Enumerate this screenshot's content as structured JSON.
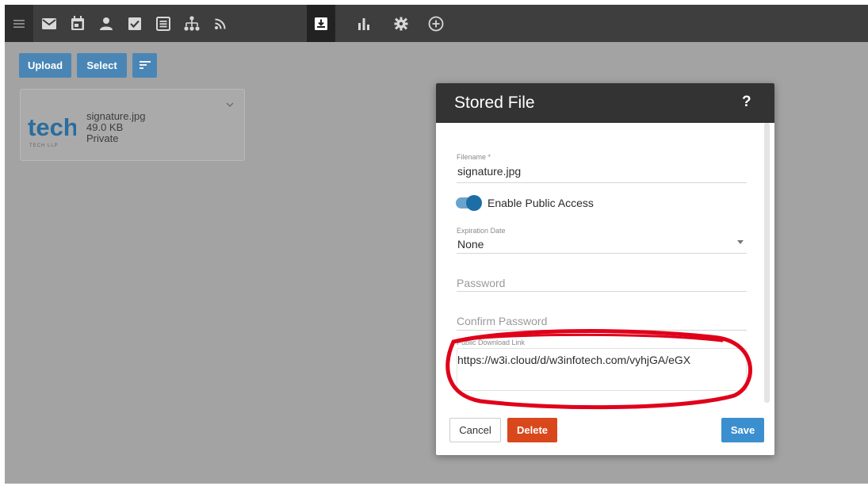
{
  "nav": {
    "icons": [
      "menu-icon",
      "mail-icon",
      "calendar-icon",
      "contacts-icon",
      "tasks-icon",
      "notes-icon",
      "org-chart-icon",
      "rss-icon",
      "files-icon",
      "reports-icon",
      "settings-icon",
      "add-icon"
    ],
    "active": "files-icon"
  },
  "toolbar": {
    "upload_label": "Upload",
    "select_label": "Select",
    "sort_icon": "sort-icon"
  },
  "file_card": {
    "filename": "signature.jpg",
    "size": "49.0 KB",
    "visibility": "Private",
    "thumb_logo_text": "tech",
    "thumb_logo_subtext": "TECH LLP"
  },
  "dialog": {
    "title": "Stored File",
    "help": "?",
    "filename_label": "Filename *",
    "filename_value": "signature.jpg",
    "public_access_label": "Enable Public Access",
    "public_access_enabled": true,
    "expiration_label": "Expiration Date",
    "expiration_value": "None",
    "password_placeholder": "Password",
    "confirm_password_placeholder": "Confirm Password",
    "download_link_label": "Public Download Link",
    "download_link_value": "https://w3i.cloud/d/w3infotech.com/vyhjGA/eGX",
    "cancel_label": "Cancel",
    "delete_label": "Delete",
    "save_label": "Save"
  },
  "colors": {
    "topbar": "#3e3e3e",
    "backdrop": "#a3a3a3",
    "primary_button": "#4a86b5",
    "delete_button": "#d9481c",
    "save_button": "#3b8fcf",
    "toggle": "#1e6ea6",
    "highlight": "#e0001a"
  }
}
